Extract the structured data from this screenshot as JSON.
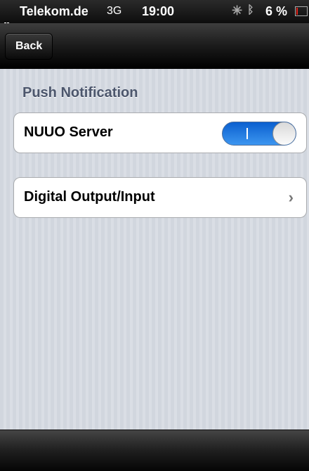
{
  "status_bar": {
    "carrier": "Telekom.de",
    "network": "3G",
    "time": "19:00",
    "battery_percent": "6 %",
    "battery_level": 0.06,
    "battery_color": "#e2231a"
  },
  "nav": {
    "back_label": "Back"
  },
  "section": {
    "header": "Push Notification"
  },
  "cells": [
    {
      "label": "NUUO Server",
      "accessory": "toggle",
      "toggle_on": true
    },
    {
      "label": "Digital Output/Input",
      "accessory": "chevron-right-icon"
    }
  ],
  "colors": {
    "toggle_on": "#1a73e0",
    "section_header": "#4c566c"
  }
}
